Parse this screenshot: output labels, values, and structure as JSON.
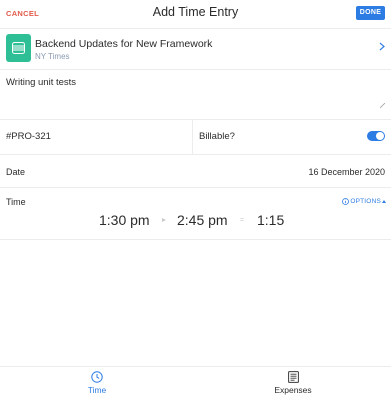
{
  "header": {
    "cancel_label": "CANCEL",
    "title": "Add Time Entry",
    "done_label": "DONE"
  },
  "project": {
    "name": "Backend Updates for New Framework",
    "client": "NY Times",
    "badge_color": "#2fbf97",
    "icon": "layers-icon"
  },
  "notes": {
    "value": "Writing unit tests"
  },
  "task": {
    "value": "#PRO-321"
  },
  "billable": {
    "label": "Billable?",
    "enabled": true
  },
  "date": {
    "label": "Date",
    "value": "16 December 2020"
  },
  "time": {
    "label": "Time",
    "options_label": "OPTIONS",
    "start": "1:30 pm",
    "end": "2:45 pm",
    "duration": "1:15"
  },
  "nav": {
    "items": [
      {
        "label": "Time",
        "icon": "clock-icon",
        "active": true
      },
      {
        "label": "Expenses",
        "icon": "receipt-icon",
        "active": false
      }
    ]
  },
  "colors": {
    "accent": "#2d7ce3",
    "cancel": "#e25b4b",
    "client_text": "#8a9ab0"
  }
}
